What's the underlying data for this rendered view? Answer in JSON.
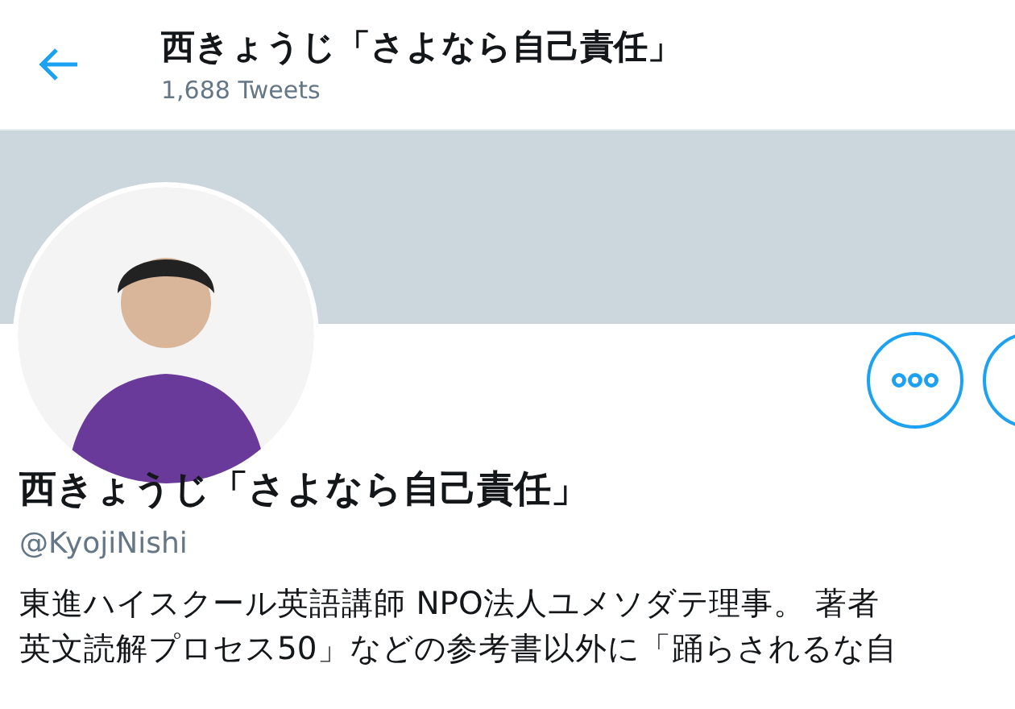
{
  "header": {
    "title": "西きょうじ「さよなら自己責任」",
    "tweet_count": "1,688 Tweets"
  },
  "profile": {
    "name": "西きょうじ「さよなら自己責任」",
    "handle": "@KyojiNishi",
    "bio_lines": [
      "東進ハイスクール英語講師 NPO法人ユメソダテ理事。 著者",
      "英文読解プロセス50」などの参考書以外に「踊らされるな自"
    ]
  }
}
